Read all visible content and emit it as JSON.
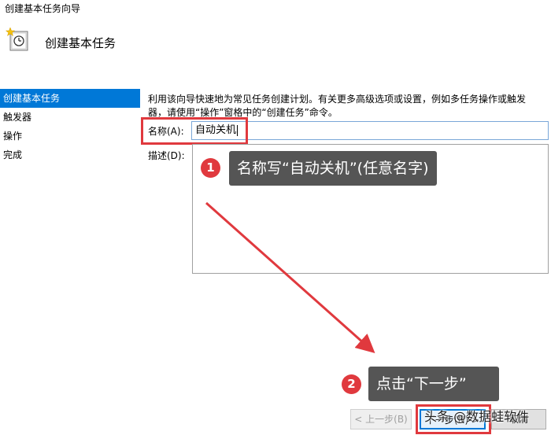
{
  "window": {
    "title": "创建基本任务向导"
  },
  "header": {
    "title": "创建基本任务",
    "icon": "task-clock-icon"
  },
  "sidebar": {
    "items": [
      {
        "label": "创建基本任务",
        "active": true
      },
      {
        "label": "触发器",
        "active": false
      },
      {
        "label": "操作",
        "active": false
      },
      {
        "label": "完成",
        "active": false
      }
    ]
  },
  "main": {
    "description": "利用该向导快速地为常见任务创建计划。有关更多高级选项或设置，例如多任务操作或触发器，请使用“操作”窗格中的“创建任务”命令。",
    "name_label": "名称(A):",
    "name_value": "自动关机",
    "desc_label": "描述(D):",
    "desc_value": ""
  },
  "annotations": {
    "step1_badge": "1",
    "step1_text": "名称写“自动关机”(任意名字)",
    "step2_badge": "2",
    "step2_text": "点击“下一步”",
    "highlight_color": "#e0393e"
  },
  "buttons": {
    "back": "< 上一步(B)",
    "next": "下一步(N) >",
    "cancel": "取消"
  },
  "watermark": "头条 @数据蛙软件"
}
